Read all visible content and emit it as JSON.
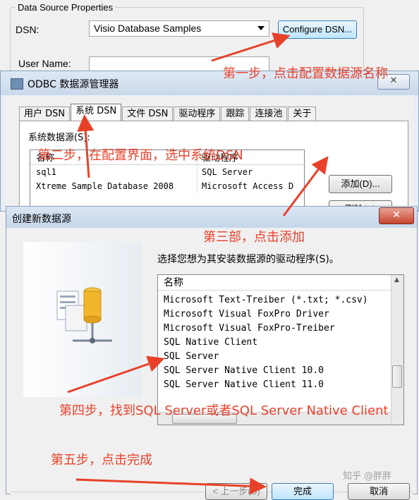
{
  "dsp": {
    "group_label": "Data Source Properties",
    "dsn_label": "DSN:",
    "dsn_value": "Visio Database Samples",
    "configure_button": "Configure DSN...",
    "user_name_label": "User Name:"
  },
  "odbc": {
    "title": "ODBC 数据源管理器",
    "close": "✕",
    "tabs": [
      "用户 DSN",
      "系统 DSN",
      "文件 DSN",
      "驱动程序",
      "跟踪",
      "连接池",
      "关于"
    ],
    "section_label": "系统数据源(S):",
    "columns": [
      "名称",
      "驱动程序"
    ],
    "rows": [
      {
        "name": "sql1",
        "driver": "SQL Server"
      },
      {
        "name": "Xtreme Sample Database 2008",
        "driver": "Microsoft Access D"
      }
    ],
    "add_button": "添加(D)...",
    "remove_button": "删除(R)"
  },
  "create": {
    "title": "创建新数据源",
    "close": "✕",
    "prompt": "选择您想为其安装数据源的驱动程序(S)。",
    "column": "名称",
    "drivers": [
      "Microsoft Text-Treiber (*.txt; *.csv)",
      "Microsoft Visual FoxPro Driver",
      "Microsoft Visual FoxPro-Treiber",
      "SQL Native Client",
      "SQL Server",
      "SQL Server Native Client 10.0",
      "SQL Server Native Client 11.0"
    ],
    "back_button": "< 上一步(B)",
    "finish_button": "完成",
    "cancel_button": "取消"
  },
  "annotations": {
    "step1": "第一步，点击配置数据源名称",
    "step2": "第二步，在配置界面，选中系统DSN",
    "step3": "第三部，点击添加",
    "step4": "第四步，找到SQL Server或者SQL Server Native Client",
    "step5": "第五步，点击完成",
    "color": "#e8412a"
  },
  "watermark": "知乎 @胖胖"
}
